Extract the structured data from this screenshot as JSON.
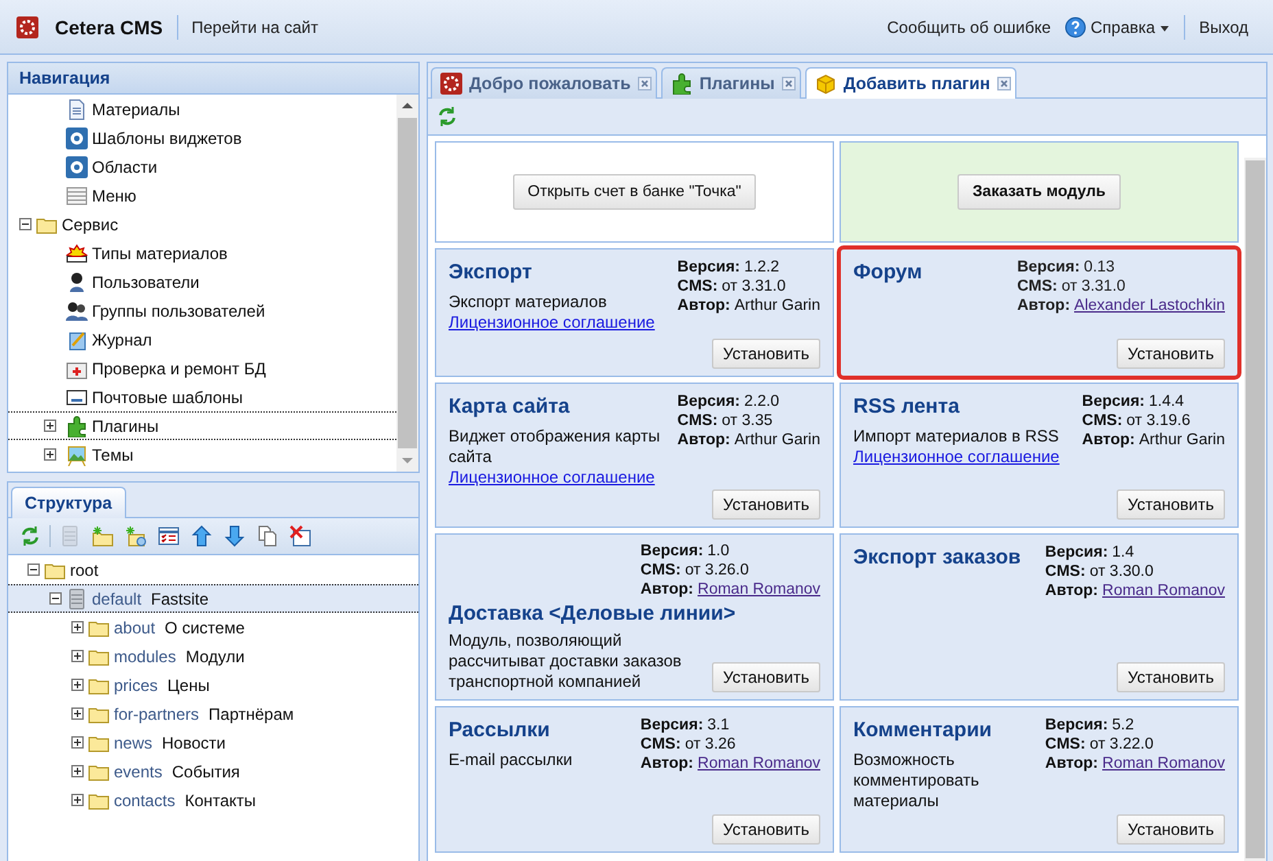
{
  "header": {
    "app_title": "Cetera CMS",
    "site_link": "Перейти на сайт",
    "report_link": "Сообщить об ошибке",
    "help_menu": "Справка",
    "logout": "Выход"
  },
  "nav": {
    "title": "Навигация",
    "tree": [
      {
        "children": [
          {
            "label": "Материалы",
            "selected": false
          },
          {
            "label": "Шаблоны виджетов",
            "selected": false
          },
          {
            "label": "Области",
            "selected": false
          },
          {
            "label": "Меню",
            "selected": false
          }
        ]
      },
      {
        "label": "Сервис",
        "expanded": true,
        "selected": false,
        "children": [
          {
            "label": "Типы материалов",
            "selected": false
          },
          {
            "label": "Пользователи",
            "selected": false
          },
          {
            "label": "Группы пользователей",
            "selected": false
          },
          {
            "label": "Журнал",
            "selected": false
          },
          {
            "label": "Проверка и ремонт БД",
            "selected": false
          },
          {
            "label": "Почтовые шаблоны",
            "selected": false
          },
          {
            "label": "Плагины",
            "expanded": false,
            "selected": true
          },
          {
            "label": "Темы",
            "expanded": false,
            "selected": false
          }
        ]
      }
    ]
  },
  "structure": {
    "tab": "Структура",
    "toolbar": [
      {
        "disabled": false
      },
      {
        "disabled": true
      },
      {
        "disabled": false
      },
      {
        "disabled": false
      },
      {
        "disabled": false
      },
      {
        "disabled": false
      },
      {
        "disabled": false
      },
      {
        "disabled": false
      },
      {
        "disabled": false
      }
    ],
    "root": {
      "label": "root",
      "expanded": true,
      "selected": false
    },
    "site": {
      "slug": "default",
      "title": "Fastsite",
      "expanded": true,
      "selected": true
    },
    "sections": [
      {
        "slug": "about",
        "title": "О системе",
        "expanded": false,
        "selected": false
      },
      {
        "slug": "modules",
        "title": "Модули",
        "expanded": false,
        "selected": false
      },
      {
        "slug": "prices",
        "title": "Цены",
        "expanded": false,
        "selected": false
      },
      {
        "slug": "for-partners",
        "title": "Партнёрам",
        "expanded": false,
        "selected": false
      },
      {
        "slug": "news",
        "title": "Новости",
        "expanded": false,
        "selected": false
      },
      {
        "slug": "events",
        "title": "События",
        "expanded": false,
        "selected": false
      },
      {
        "slug": "contacts",
        "title": "Контакты",
        "expanded": false,
        "selected": false
      }
    ]
  },
  "tabs": [
    {
      "label": "Добро пожаловать",
      "selected": false
    },
    {
      "label": "Плагины",
      "selected": false
    },
    {
      "label": "Добавить плагин",
      "selected": true
    }
  ],
  "promo": [
    {
      "button": "Открыть счет в банке \"Точка\"",
      "highlighted": false
    },
    {
      "button": "Заказать модуль",
      "highlighted": true
    }
  ],
  "plugins": [
    {
      "kind": "side",
      "name": "Экспорт",
      "highlighted": false,
      "meta": [
        {
          "label": "Версия:",
          "value": "1.2.2",
          "link": false
        },
        {
          "label": "CMS:",
          "value": "от 3.31.0",
          "link": false
        },
        {
          "label": "Автор:",
          "value": "Arthur Garin",
          "link": false
        }
      ],
      "description": "Экспорт материалов",
      "license": "Лицензионное соглашение",
      "button": "Установить"
    },
    {
      "kind": "side",
      "name": "Форум",
      "highlighted": true,
      "meta": [
        {
          "label": "Версия:",
          "value": "0.13",
          "link": false
        },
        {
          "label": "CMS:",
          "value": "от 3.31.0",
          "link": false
        },
        {
          "label": "Автор:",
          "value": "Alexander Lastochkin",
          "link": true
        }
      ],
      "button": "Установить"
    },
    {
      "kind": "side",
      "name": "Карта сайта",
      "highlighted": false,
      "meta": [
        {
          "label": "Версия:",
          "value": "2.2.0",
          "link": false
        },
        {
          "label": "CMS:",
          "value": "от 3.35",
          "link": false
        },
        {
          "label": "Автор:",
          "value": "Arthur Garin",
          "link": false
        }
      ],
      "description": "Виджет отображения карты сайта",
      "license": "Лицензионное соглашение",
      "button": "Установить"
    },
    {
      "kind": "side",
      "name": "RSS лента",
      "highlighted": false,
      "meta": [
        {
          "label": "Версия:",
          "value": "1.4.4",
          "link": false
        },
        {
          "label": "CMS:",
          "value": "от 3.19.6",
          "link": false
        },
        {
          "label": "Автор:",
          "value": "Arthur Garin",
          "link": false
        }
      ],
      "description": "Импорт материалов в RSS",
      "license": "Лицензионное соглашение",
      "button": "Установить"
    },
    {
      "kind": "stacked",
      "name": "Доставка <Деловые линии>",
      "highlighted": false,
      "meta": [
        {
          "label": "Версия:",
          "value": "1.0",
          "link": false
        },
        {
          "label": "CMS:",
          "value": "от 3.26.0",
          "link": false
        },
        {
          "label": "Автор:",
          "value": "Roman Romanov",
          "link": true
        }
      ],
      "description": "Модуль, позволяющий рассчитыват доставки заказов транспортной компанией",
      "button": "Установить"
    },
    {
      "kind": "side",
      "name": "Экспорт заказов",
      "highlighted": false,
      "meta": [
        {
          "label": "Версия:",
          "value": "1.4",
          "link": false
        },
        {
          "label": "CMS:",
          "value": "от 3.30.0",
          "link": false
        },
        {
          "label": "Автор:",
          "value": "Roman Romanov",
          "link": true
        }
      ],
      "button": "Установить"
    },
    {
      "kind": "side",
      "name": "Рассылки",
      "highlighted": false,
      "meta": [
        {
          "label": "Версия:",
          "value": "3.1",
          "link": false
        },
        {
          "label": "CMS:",
          "value": "от 3.26",
          "link": false
        },
        {
          "label": "Автор:",
          "value": "Roman Romanov",
          "link": true
        }
      ],
      "description": "E-mail рассылки",
      "button": "Установить"
    },
    {
      "kind": "side",
      "name": "Комментарии",
      "highlighted": false,
      "meta": [
        {
          "label": "Версия:",
          "value": "5.2",
          "link": false
        },
        {
          "label": "CMS:",
          "value": "от 3.22.0",
          "link": false
        },
        {
          "label": "Автор:",
          "value": "Roman Romanov",
          "link": true
        }
      ],
      "description": "Возможность комментировать материалы",
      "button": "Установить"
    }
  ]
}
